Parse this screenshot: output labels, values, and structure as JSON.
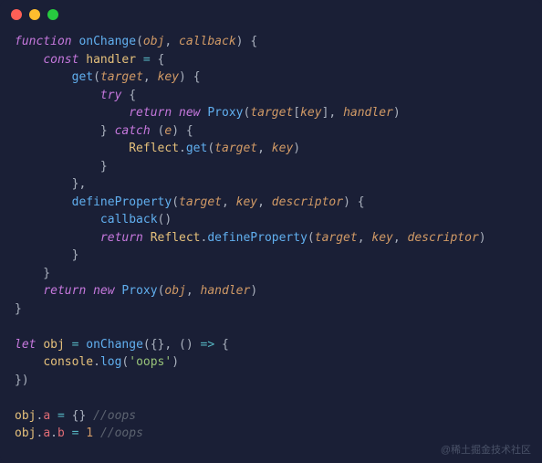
{
  "titlebar": {
    "buttons": [
      "close",
      "minimize",
      "zoom"
    ]
  },
  "code": {
    "tokens": [
      [
        [
          "kw",
          "function"
        ],
        [
          "punct",
          " "
        ],
        [
          "fn",
          "onChange"
        ],
        [
          "punct",
          "("
        ],
        [
          "param",
          "obj"
        ],
        [
          "punct",
          ", "
        ],
        [
          "param",
          "callback"
        ],
        [
          "punct",
          ") {"
        ]
      ],
      [
        [
          "punct",
          "    "
        ],
        [
          "kw",
          "const"
        ],
        [
          "punct",
          " "
        ],
        [
          "var",
          "handler"
        ],
        [
          "punct",
          " "
        ],
        [
          "op",
          "="
        ],
        [
          "punct",
          " {"
        ]
      ],
      [
        [
          "punct",
          "        "
        ],
        [
          "fn",
          "get"
        ],
        [
          "punct",
          "("
        ],
        [
          "param",
          "target"
        ],
        [
          "punct",
          ", "
        ],
        [
          "param",
          "key"
        ],
        [
          "punct",
          ") {"
        ]
      ],
      [
        [
          "punct",
          "            "
        ],
        [
          "kw",
          "try"
        ],
        [
          "punct",
          " {"
        ]
      ],
      [
        [
          "punct",
          "                "
        ],
        [
          "ret",
          "return"
        ],
        [
          "punct",
          " "
        ],
        [
          "kw",
          "new"
        ],
        [
          "punct",
          " "
        ],
        [
          "fn",
          "Proxy"
        ],
        [
          "punct",
          "("
        ],
        [
          "param",
          "target"
        ],
        [
          "punct",
          "["
        ],
        [
          "param",
          "key"
        ],
        [
          "punct",
          "], "
        ],
        [
          "param",
          "handler"
        ],
        [
          "punct",
          ")"
        ]
      ],
      [
        [
          "punct",
          "            } "
        ],
        [
          "kw",
          "catch"
        ],
        [
          "punct",
          " ("
        ],
        [
          "param",
          "e"
        ],
        [
          "punct",
          ") {"
        ]
      ],
      [
        [
          "punct",
          "                "
        ],
        [
          "var",
          "Reflect"
        ],
        [
          "punct",
          "."
        ],
        [
          "fn",
          "get"
        ],
        [
          "punct",
          "("
        ],
        [
          "param",
          "target"
        ],
        [
          "punct",
          ", "
        ],
        [
          "param",
          "key"
        ],
        [
          "punct",
          ")"
        ]
      ],
      [
        [
          "punct",
          "            }"
        ]
      ],
      [
        [
          "punct",
          "        },"
        ]
      ],
      [
        [
          "punct",
          "        "
        ],
        [
          "fn",
          "defineProperty"
        ],
        [
          "punct",
          "("
        ],
        [
          "param",
          "target"
        ],
        [
          "punct",
          ", "
        ],
        [
          "param",
          "key"
        ],
        [
          "punct",
          ", "
        ],
        [
          "param",
          "descriptor"
        ],
        [
          "punct",
          ") {"
        ]
      ],
      [
        [
          "punct",
          "            "
        ],
        [
          "fn",
          "callback"
        ],
        [
          "punct",
          "()"
        ]
      ],
      [
        [
          "punct",
          "            "
        ],
        [
          "ret",
          "return"
        ],
        [
          "punct",
          " "
        ],
        [
          "var",
          "Reflect"
        ],
        [
          "punct",
          "."
        ],
        [
          "fn",
          "defineProperty"
        ],
        [
          "punct",
          "("
        ],
        [
          "param",
          "target"
        ],
        [
          "punct",
          ", "
        ],
        [
          "param",
          "key"
        ],
        [
          "punct",
          ", "
        ],
        [
          "param",
          "descriptor"
        ],
        [
          "punct",
          ")"
        ]
      ],
      [
        [
          "punct",
          "        }"
        ]
      ],
      [
        [
          "punct",
          "    }"
        ]
      ],
      [
        [
          "punct",
          "    "
        ],
        [
          "ret",
          "return"
        ],
        [
          "punct",
          " "
        ],
        [
          "kw",
          "new"
        ],
        [
          "punct",
          " "
        ],
        [
          "fn",
          "Proxy"
        ],
        [
          "punct",
          "("
        ],
        [
          "param",
          "obj"
        ],
        [
          "punct",
          ", "
        ],
        [
          "param",
          "handler"
        ],
        [
          "punct",
          ")"
        ]
      ],
      [
        [
          "punct",
          "}"
        ]
      ],
      [
        [
          "punct",
          ""
        ]
      ],
      [
        [
          "kw",
          "let"
        ],
        [
          "punct",
          " "
        ],
        [
          "var",
          "obj"
        ],
        [
          "punct",
          " "
        ],
        [
          "op",
          "="
        ],
        [
          "punct",
          " "
        ],
        [
          "fn",
          "onChange"
        ],
        [
          "punct",
          "({}, () "
        ],
        [
          "op",
          "=>"
        ],
        [
          "punct",
          " {"
        ]
      ],
      [
        [
          "punct",
          "    "
        ],
        [
          "var",
          "console"
        ],
        [
          "punct",
          "."
        ],
        [
          "fn",
          "log"
        ],
        [
          "punct",
          "("
        ],
        [
          "str",
          "'oops'"
        ],
        [
          "punct",
          ")"
        ]
      ],
      [
        [
          "punct",
          "})"
        ]
      ],
      [
        [
          "punct",
          ""
        ]
      ],
      [
        [
          "var",
          "obj"
        ],
        [
          "punct",
          "."
        ],
        [
          "prop",
          "a"
        ],
        [
          "punct",
          " "
        ],
        [
          "op",
          "="
        ],
        [
          "punct",
          " {} "
        ],
        [
          "cmt",
          "//oops"
        ]
      ],
      [
        [
          "var",
          "obj"
        ],
        [
          "punct",
          "."
        ],
        [
          "prop",
          "a"
        ],
        [
          "punct",
          "."
        ],
        [
          "prop",
          "b"
        ],
        [
          "punct",
          " "
        ],
        [
          "op",
          "="
        ],
        [
          "punct",
          " "
        ],
        [
          "num",
          "1"
        ],
        [
          "punct",
          " "
        ],
        [
          "cmt",
          "//oops"
        ]
      ]
    ]
  },
  "watermark": "@稀土掘金技术社区"
}
